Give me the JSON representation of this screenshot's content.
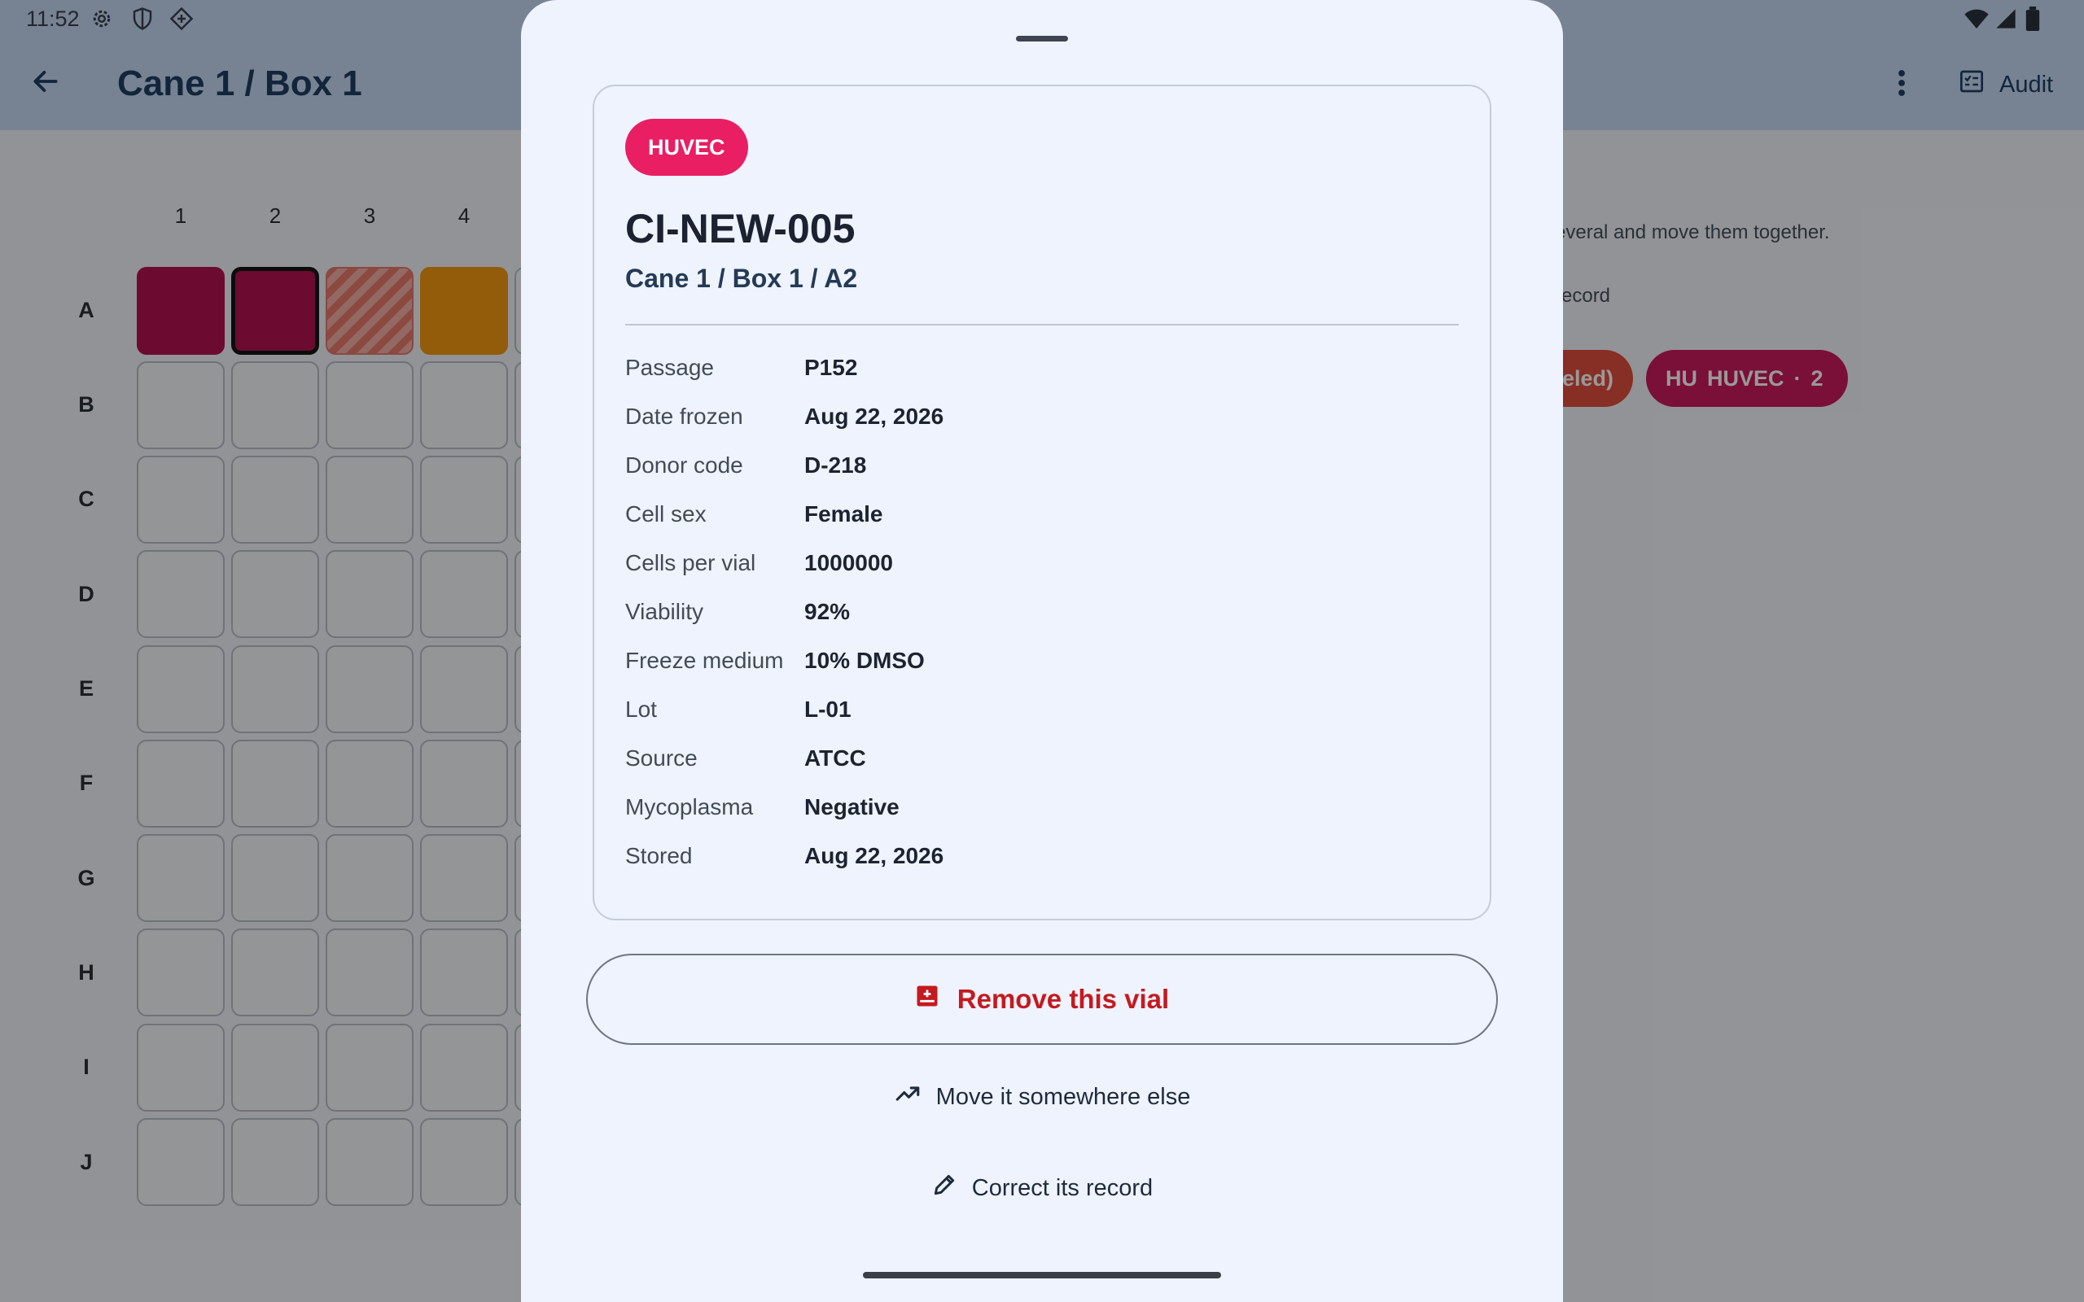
{
  "status_bar": {
    "time": "11:52"
  },
  "header": {
    "title": "Cane 1 / Box 1",
    "audit_label": "Audit"
  },
  "grid": {
    "columns": [
      "1",
      "2",
      "3",
      "4"
    ],
    "rows": [
      "A",
      "B",
      "C",
      "D",
      "E",
      "F",
      "G",
      "H",
      "I",
      "J"
    ]
  },
  "background_hints": {
    "select_hint": "everal and move them together.",
    "record_hint": "record",
    "chip_partial": "eled)",
    "chip_huvec": {
      "abbr": "HU",
      "name": "HUVEC",
      "sep": "·",
      "count": "2"
    }
  },
  "sheet": {
    "tag": "HUVEC",
    "vial_id": "CI-NEW-005",
    "location": "Cane 1 / Box 1 / A2",
    "fields": [
      {
        "label": "Passage",
        "value": "P152"
      },
      {
        "label": "Date frozen",
        "value": "Aug 22, 2026"
      },
      {
        "label": "Donor code",
        "value": "D-218"
      },
      {
        "label": "Cell sex",
        "value": "Female"
      },
      {
        "label": "Cells per vial",
        "value": "1000000"
      },
      {
        "label": "Viability",
        "value": "92%"
      },
      {
        "label": "Freeze medium",
        "value": "10% DMSO"
      },
      {
        "label": "Lot",
        "value": "L-01"
      },
      {
        "label": "Source",
        "value": "ATCC"
      },
      {
        "label": "Mycoplasma",
        "value": "Negative"
      },
      {
        "label": "Stored",
        "value": "Aug 22, 2026"
      }
    ],
    "remove_label": "Remove this vial",
    "move_label": "Move it somewhere else",
    "correct_label": "Correct its record"
  },
  "colors": {
    "magenta": "#b5134f",
    "amber": "#f39a11",
    "tag": "#e91e63",
    "danger": "#c41a20"
  },
  "icons": [
    "back-arrow-icon",
    "more-vert-icon",
    "audit-checklist-icon",
    "remove-vial-icon",
    "trending-up-icon",
    "pencil-icon",
    "settings-icon",
    "shield-icon",
    "diamond-icon",
    "wifi-icon",
    "signal-icon",
    "battery-icon"
  ]
}
